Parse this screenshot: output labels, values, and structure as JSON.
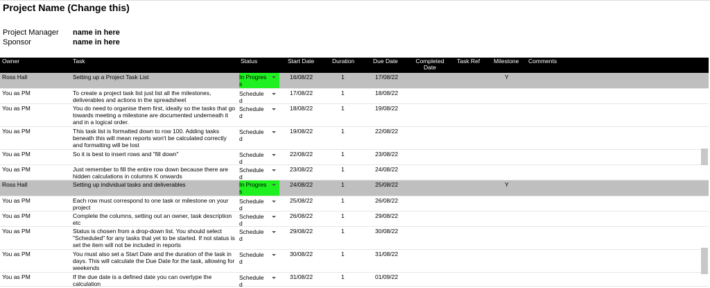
{
  "project": {
    "title": "Project Name (Change this)",
    "manager_label": "Project Manager",
    "manager_value": "name in here",
    "sponsor_label": "Sponsor",
    "sponsor_value": "name in here"
  },
  "columns": {
    "owner": "Owner",
    "task": "Task",
    "status": "Status",
    "start": "Start Date",
    "duration": "Duration",
    "due": "Due Date",
    "completed": "Completed Date",
    "ref": "Task Ref",
    "milestone": "Milestone",
    "comments": "Comments"
  },
  "rows": [
    {
      "owner": "Ross Hall",
      "task": "Setting up a Project Task List",
      "status": "In Progress",
      "start": "16/08/22",
      "duration": "1",
      "due": "17/08/22",
      "milestone": "Y",
      "is_milestone": true
    },
    {
      "owner": "You as PM",
      "task": "To create a project task list just list all the milestones, deliverables and actions in the spreadsheet",
      "status": "Scheduled",
      "start": "17/08/22",
      "duration": "1",
      "due": "18/08/22",
      "milestone": "",
      "is_milestone": false
    },
    {
      "owner": "You as PM",
      "task": "You do need to organise them first, ideally so the tasks that go towards meeting a milestone are documented underneath it and in a logical order.",
      "status": "Scheduled",
      "start": "18/08/22",
      "duration": "1",
      "due": "19/08/22",
      "milestone": "",
      "is_milestone": false
    },
    {
      "owner": "You as PM",
      "task": "This task list is formatted down to row 100. Adding tasks beneath this will mean reports won't be calculated correctly and formatting will be lost",
      "status": "Scheduled",
      "start": "19/08/22",
      "duration": "1",
      "due": "22/08/22",
      "milestone": "",
      "is_milestone": false
    },
    {
      "owner": "You as PM",
      "task": "So it is best to insert rows and \"fill down\"",
      "status": "Scheduled",
      "start": "22/08/22",
      "duration": "1",
      "due": "23/08/22",
      "milestone": "",
      "is_milestone": false
    },
    {
      "owner": "You as PM",
      "task": "Just remember to fill the entire row down because there are hidden calculations in columns K onwards",
      "status": "Scheduled",
      "start": "23/08/22",
      "duration": "1",
      "due": "24/08/22",
      "milestone": "",
      "is_milestone": false
    },
    {
      "owner": "Ross Hall",
      "task": "Setting up individual tasks and deliverables",
      "status": "In Progress",
      "start": "24/08/22",
      "duration": "1",
      "due": "25/08/22",
      "milestone": "Y",
      "is_milestone": true
    },
    {
      "owner": "You as PM",
      "task": "Each row must correspond to one task or milestone on your project",
      "status": "Scheduled",
      "start": "25/08/22",
      "duration": "1",
      "due": "26/08/22",
      "milestone": "",
      "is_milestone": false
    },
    {
      "owner": "You as PM",
      "task": "Complete the columns, setting out an owner, task description etc",
      "status": "Scheduled",
      "start": "26/08/22",
      "duration": "1",
      "due": "29/08/22",
      "milestone": "",
      "is_milestone": false
    },
    {
      "owner": "You as PM",
      "task": "Status is chosen from a drop-down list. You should select \"Scheduled\" for any tasks that yet to be started. If not status is set the item will not be included in reports",
      "status": "Scheduled",
      "start": "29/08/22",
      "duration": "1",
      "due": "30/08/22",
      "milestone": "",
      "is_milestone": false
    },
    {
      "owner": "You as PM",
      "task": "You must also set a Start Date and the duration of the task in days. This will calculate the Due Date for the task, allowing for weekends",
      "status": "Scheduled",
      "start": "30/08/22",
      "duration": "1",
      "due": "31/08/22",
      "milestone": "",
      "is_milestone": false
    },
    {
      "owner": "You as PM",
      "task": "If the due date is a defined date you can overtype the calculation",
      "status": "Scheduled",
      "start": "31/08/22",
      "duration": "1",
      "due": "01/09/22",
      "milestone": "",
      "is_milestone": false
    }
  ],
  "colors": {
    "header_bg": "#000000",
    "milestone_row": "#bfbfbf",
    "in_progress": "#1ff01f"
  }
}
